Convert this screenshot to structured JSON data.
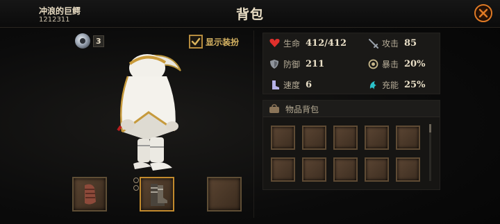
{
  "header": {
    "player_name": "冲浪的巨鳄",
    "player_id": "1212311",
    "title": "背包",
    "close_icon": "close-icon"
  },
  "currency": {
    "icon": "coin-icon",
    "count": "3"
  },
  "show_dress": {
    "label": "显示装扮",
    "checked": true
  },
  "equipment": {
    "slots": [
      {
        "name": "glove",
        "icon": "glove-icon"
      },
      {
        "name": "boots",
        "icon": "boots-icon",
        "active": true
      },
      {
        "name": "empty",
        "icon": ""
      }
    ]
  },
  "stats": [
    {
      "label": "生命",
      "value": "412/412",
      "icon": "heart-icon",
      "color": "#e0302c"
    },
    {
      "label": "攻击",
      "value": "85",
      "icon": "sword-icon",
      "color": "#9aa1aa"
    },
    {
      "label": "防御",
      "value": "211",
      "icon": "shield-icon",
      "color": "#9aa1aa"
    },
    {
      "label": "暴击",
      "value": "20%",
      "icon": "crit-icon",
      "color": "#c7b78a"
    },
    {
      "label": "速度",
      "value": "6",
      "icon": "boot-speed-icon",
      "color": "#b6b3e8"
    },
    {
      "label": "充能",
      "value": "25%",
      "icon": "energy-icon",
      "color": "#2bc1c9"
    }
  ],
  "inventory": {
    "title": "物品背包",
    "icon": "bag-icon",
    "slot_count": 10
  }
}
